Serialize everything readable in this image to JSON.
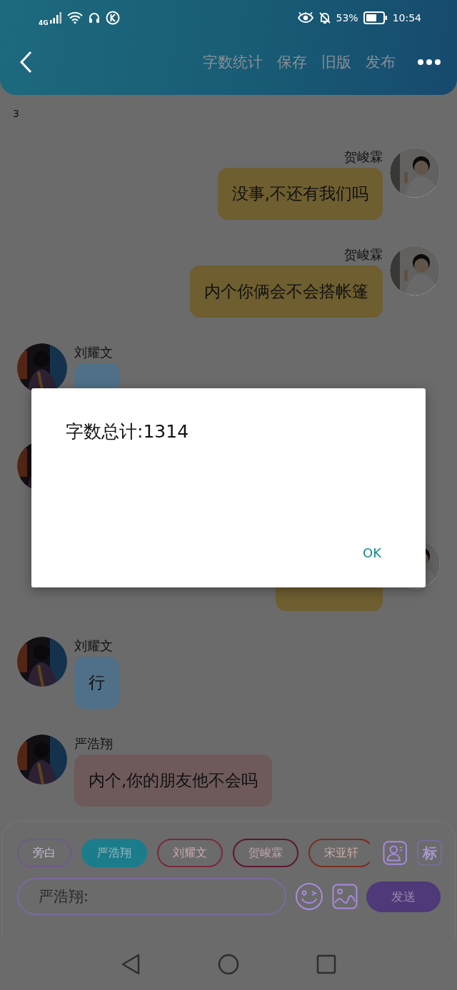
{
  "status_bar": {
    "network": "4G",
    "battery_percent": "53%",
    "time": "10:54"
  },
  "header": {
    "actions": [
      "字数统计",
      "保存",
      "旧版",
      "发布"
    ]
  },
  "chat": {
    "page_marker": "3",
    "messages": [
      {
        "kind": "outgoing",
        "sender": "贺峻霖",
        "text": "没事,不还有我们吗",
        "color": "#6e5e30"
      },
      {
        "kind": "outgoing",
        "sender": "贺峻霖",
        "text": "内个你俩会不会搭帐篷",
        "color": "#6e5e30"
      },
      {
        "kind": "incoming",
        "sender": "刘耀文",
        "color": "#4f7088"
      },
      {
        "kind": "incoming"
      },
      {
        "kind": "outgoing",
        "color": "#6e5e30"
      },
      {
        "kind": "incoming",
        "sender": "刘耀文",
        "text": "行",
        "color": "#4f7088"
      },
      {
        "kind": "incoming",
        "sender": "严浩翔",
        "text": "内个,你的朋友他不会吗",
        "color": "#6e5a5a"
      }
    ]
  },
  "dialog": {
    "message": "字数总计:1314",
    "button": "OK"
  },
  "composer": {
    "roles": [
      {
        "label": "旁白",
        "color": "#6e5a8a",
        "selected": false
      },
      {
        "label": "严浩翔",
        "color": "#1b7d8c",
        "selected": true
      },
      {
        "label": "刘耀文",
        "color": "#7a2a3a",
        "selected": false
      },
      {
        "label": "贺峻霖",
        "color": "#5e1632",
        "selected": false
      },
      {
        "label": "宋亚轩",
        "color": "#7a2e22",
        "selected": false
      }
    ],
    "tag_button": "标",
    "input_value": "严浩翔:",
    "send_button": "发送"
  }
}
